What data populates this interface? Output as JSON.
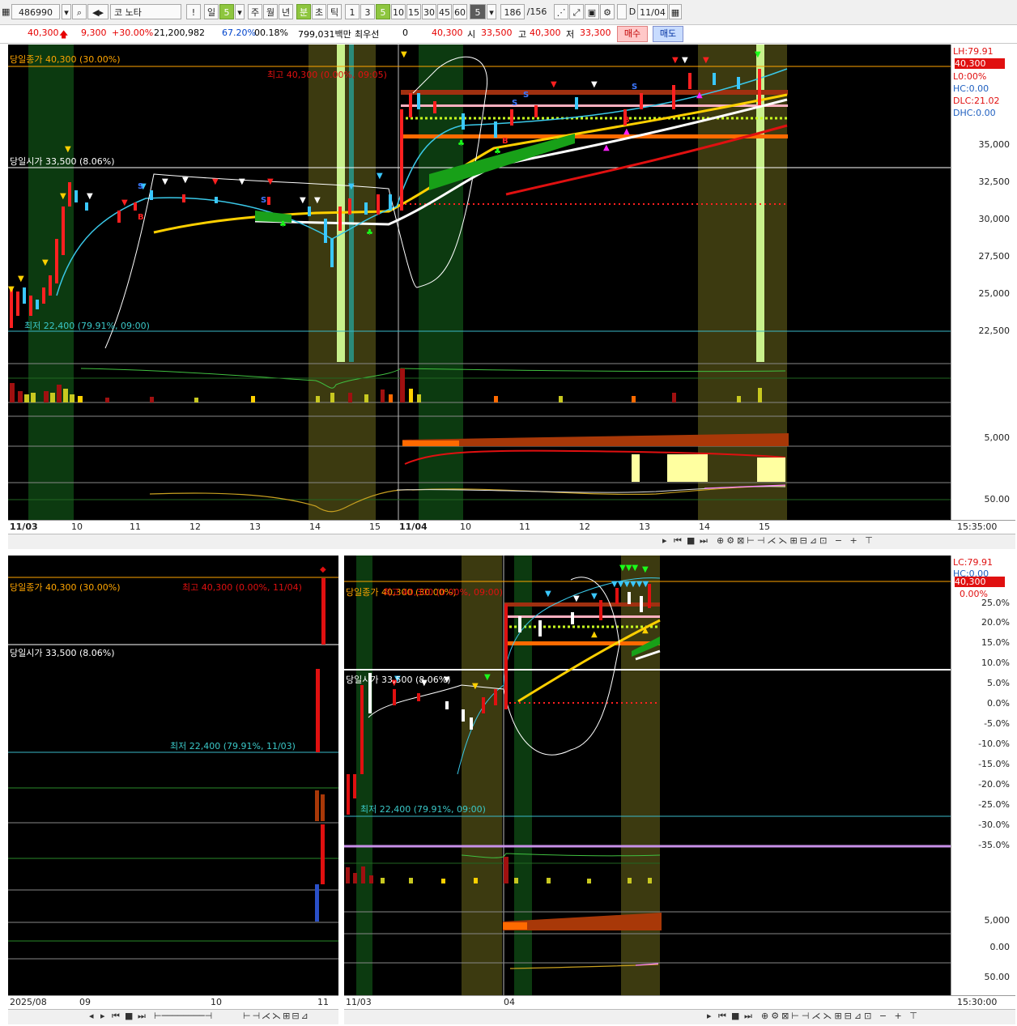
{
  "toolbar": {
    "code": "486990",
    "search_icon": "search-icon",
    "name": "코 노타",
    "alert_label": "!",
    "period_day": "일",
    "period_val": "5",
    "period_week": "주",
    "period_month": "월",
    "period_year": "년",
    "period_min": "분",
    "period_sec": "초",
    "period_tick": "틱",
    "n1": "1",
    "n3": "3",
    "n5": "5",
    "n10": "10",
    "n15": "15",
    "n30": "30",
    "n45": "45",
    "n60": "60",
    "count": "5",
    "bars": "186",
    "bars_total": "/156",
    "date_label": "D",
    "date": "11/04"
  },
  "quote": {
    "price": "40,300",
    "change": "9,300",
    "rate": "+30.00%",
    "volume": "21,200,982",
    "turnover_rate": "67.20%",
    "misc": "00.18%",
    "amount": "799,031백만",
    "best_label": "최우선",
    "best_val": "0",
    "current": "40,300",
    "open_label": "시",
    "open": "33,500",
    "high_label": "고",
    "high": "40,300",
    "low_label": "저",
    "low": "33,300",
    "buy": "매수",
    "sell": "매도"
  },
  "main": {
    "close_label": "당일종가 40,300 (30.00%)",
    "open_label": "당일시가 33,500 (8.06%)",
    "high_label": "최고 40,300 (0.00%, 09:05)",
    "low_label": "최저 22,400 (79.91%, 09:00)",
    "info": [
      "LH:79.91",
      "40,300",
      "L0:00%",
      "HC:0.00",
      "DLC:21.02",
      "DHC:0.00"
    ],
    "y_ticks": [
      "35,000",
      "32,500",
      "30,000",
      "27,500",
      "25,000",
      "22,500"
    ],
    "vol_tick": "5,000",
    "osc_tick": "50.00",
    "x_ticks": [
      "11/03",
      "10",
      "11",
      "12",
      "13",
      "14",
      "15",
      "11/04",
      "10",
      "11",
      "12",
      "13",
      "14",
      "15"
    ],
    "time": "15:35:00"
  },
  "left": {
    "close_label": "당일종가 40,300 (30.00%)",
    "open_label": "당일시가 33,500 (8.06%)",
    "high_label": "최고 40,300 (0.00%, 11/04)",
    "low_label": "최저 22,400 (79.91%, 11/03)",
    "x_ticks": [
      "2025/08",
      "09",
      "10",
      "11"
    ]
  },
  "right": {
    "close_label": "당일종가 40,300 (30.00%)",
    "open_label": "당일시가 33,500 (8.06%)",
    "high_label": "최고 40,300 (0.00%, 09:00)",
    "low_label": "최저 22,400 (79.91%, 09:00)",
    "info": [
      "LC:79.91",
      "HC:0.00",
      "40,300",
      "0.00%"
    ],
    "y_ticks": [
      "25.0%",
      "20.0%",
      "15.0%",
      "10.0%",
      "5.0%",
      "0.0%",
      "-5.0%",
      "-10.0%",
      "-15.0%",
      "-20.0%",
      "-25.0%",
      "-30.0%",
      "-35.0%"
    ],
    "vol_tick": "5,000",
    "zero_tick": "0.00",
    "osc_tick": "50.00",
    "x_ticks": [
      "11/03",
      "04"
    ],
    "time": "15:30:00"
  },
  "colors": {
    "up": "#ff2020",
    "down": "#3ac8ff",
    "close_line": "#ffa500",
    "highlight": "#c8f08c",
    "zone_dark": "#0c3a10",
    "zone_olive": "#3c3a10"
  }
}
